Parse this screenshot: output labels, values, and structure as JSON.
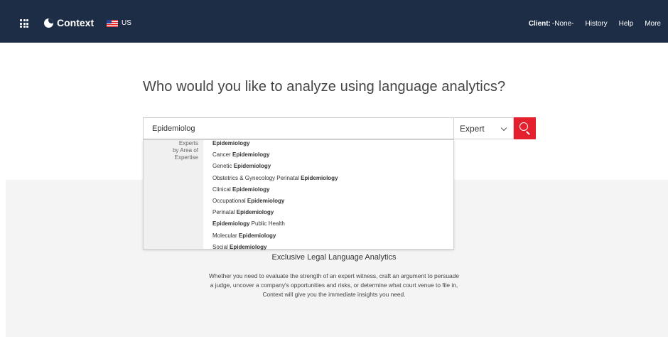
{
  "header": {
    "brand": "Context",
    "country": "US",
    "client_label": "Client:",
    "client_value": "-None-",
    "nav": [
      "History",
      "Help",
      "More"
    ]
  },
  "main": {
    "headline": "Who would you like to analyze using language analytics?",
    "search": {
      "value": "Epidemiolog",
      "type_selected": "Expert"
    },
    "suggestions": {
      "group_label": [
        "Experts",
        "by Area of",
        "Expertise"
      ],
      "items": [
        {
          "pre": "",
          "bold": "Epidemiology",
          "post": ""
        },
        {
          "pre": "Cancer ",
          "bold": "Epidemiology",
          "post": ""
        },
        {
          "pre": "Genetic ",
          "bold": "Epidemiology",
          "post": ""
        },
        {
          "pre": "Obstetrics & Gynecology Perinatal ",
          "bold": "Epidemiology",
          "post": ""
        },
        {
          "pre": "Clinical ",
          "bold": "Epidemiology",
          "post": ""
        },
        {
          "pre": "Occupational ",
          "bold": "Epidemiology",
          "post": ""
        },
        {
          "pre": "Perinatal ",
          "bold": "Epidemiology",
          "post": ""
        },
        {
          "pre": "",
          "bold": "Epidemiology",
          "post": " Public Health"
        },
        {
          "pre": "Molecular ",
          "bold": "Epidemiology",
          "post": ""
        },
        {
          "pre": "Social ",
          "bold": "Epidemiology",
          "post": ""
        }
      ]
    },
    "tagline": "Exclusive Legal Language Analytics",
    "description": [
      "Whether you need to evaluate the strength of an expert witness, craft an argument to persuade",
      "a judge, uncover a company's opportunities and risks, or determine what court venue to file in,",
      "Context will give you the immediate insights you need."
    ]
  },
  "colors": {
    "header_bg": "#1c2d45",
    "accent": "#e4202f",
    "panel_bg": "#f4f4f4"
  },
  "icons": [
    "app-grid-icon",
    "context-logo-icon",
    "us-flag-icon",
    "chevron-down-icon",
    "search-icon"
  ]
}
